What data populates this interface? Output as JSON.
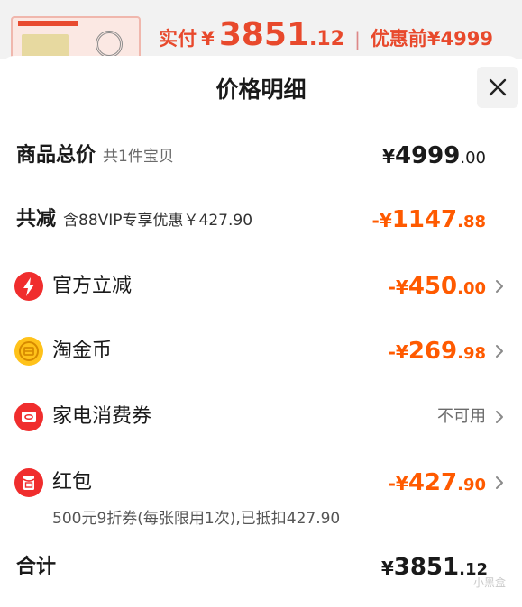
{
  "background": {
    "price_label": "实付",
    "price_yen": "¥",
    "price_int": "3851",
    "price_dec": ".12",
    "before_label": "优惠前¥4999"
  },
  "sheet": {
    "title": "价格明细"
  },
  "rows": {
    "total": {
      "label": "商品总价",
      "sub": "共1件宝贝",
      "yen": "¥",
      "int": "4999",
      "dec": ".00"
    },
    "reduce": {
      "label": "共减",
      "sub": "含88VIP专享优惠￥427.90",
      "yen": "-¥",
      "int": "1147",
      "dec": ".88"
    },
    "official": {
      "label": "官方立减",
      "yen": "-¥",
      "int": "450",
      "dec": ".00"
    },
    "coins": {
      "label": "淘金币",
      "yen": "-¥",
      "int": "269",
      "dec": ".98"
    },
    "appliance": {
      "label": "家电消费券",
      "status": "不可用"
    },
    "redpacket": {
      "label": "红包",
      "yen": "-¥",
      "int": "427",
      "dec": ".90",
      "note": "500元9折券(每张限用1次),已抵扣427.90"
    },
    "sum": {
      "label": "合计",
      "yen": "¥",
      "int": "3851",
      "dec": ".12"
    }
  },
  "watermark": "小黑盒",
  "colors": {
    "accent": "#ff5a00",
    "red_icon": "#f02d2d",
    "gold_icon": "#ffc21a"
  }
}
